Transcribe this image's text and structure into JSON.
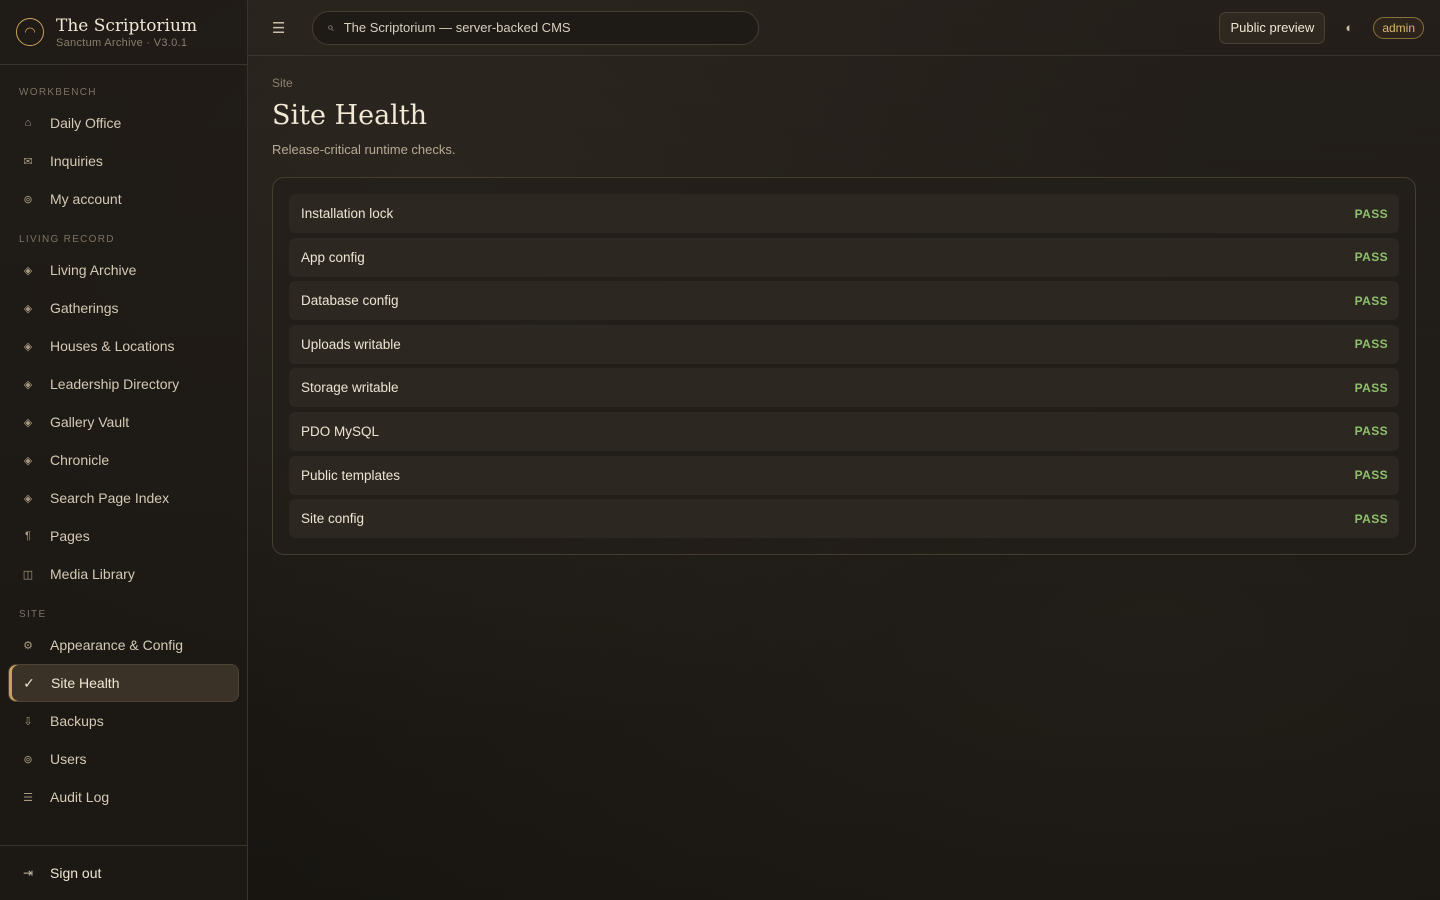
{
  "brand": {
    "title": "The Scriptorium",
    "subtitle": "Sanctum Archive · V3.0.1",
    "logo_icon": "circle-logo-icon"
  },
  "sidebar": {
    "sections": [
      {
        "label": "WORKBENCH",
        "items": [
          {
            "label": "Daily Office",
            "icon": "home-icon",
            "glyph": "⌂"
          },
          {
            "label": "Inquiries",
            "icon": "mail-icon",
            "glyph": "✉"
          },
          {
            "label": "My account",
            "icon": "account-icon",
            "glyph": "⊚"
          }
        ]
      },
      {
        "label": "LIVING RECORD",
        "items": [
          {
            "label": "Living Archive",
            "icon": "diamond-icon",
            "glyph": "◈"
          },
          {
            "label": "Gatherings",
            "icon": "diamond-icon",
            "glyph": "◈"
          },
          {
            "label": "Houses & Locations",
            "icon": "diamond-icon",
            "glyph": "◈"
          },
          {
            "label": "Leadership Directory",
            "icon": "diamond-icon",
            "glyph": "◈"
          },
          {
            "label": "Gallery Vault",
            "icon": "diamond-icon",
            "glyph": "◈"
          },
          {
            "label": "Chronicle",
            "icon": "diamond-icon",
            "glyph": "◈"
          },
          {
            "label": "Search Page Index",
            "icon": "diamond-icon",
            "glyph": "◈"
          },
          {
            "label": "Pages",
            "icon": "pilcrow-icon",
            "glyph": "¶"
          },
          {
            "label": "Media Library",
            "icon": "book-icon",
            "glyph": "◫"
          }
        ]
      },
      {
        "label": "SITE",
        "items": [
          {
            "label": "Appearance & Config",
            "icon": "gear-icon",
            "glyph": "⚙"
          },
          {
            "label": "Site Health",
            "icon": "check-icon",
            "glyph": "✓",
            "active": true
          },
          {
            "label": "Backups",
            "icon": "download-icon",
            "glyph": "⇩"
          },
          {
            "label": "Users",
            "icon": "users-icon",
            "glyph": "⊚"
          },
          {
            "label": "Audit Log",
            "icon": "list-icon",
            "glyph": "☰"
          }
        ]
      }
    ],
    "signout": {
      "label": "Sign out",
      "icon": "sign-out-icon",
      "glyph": "⇥"
    }
  },
  "topbar": {
    "menu_icon": "hamburger-icon",
    "search_icon": "search-icon",
    "search_placeholder": "The Scriptorium — server-backed CMS",
    "preview_label": "Public preview",
    "theme_icon": "theme-toggle-icon",
    "user_badge": "admin"
  },
  "page": {
    "breadcrumb": "Site",
    "title": "Site Health",
    "subtitle": "Release-critical runtime checks."
  },
  "checks": [
    {
      "name": "Installation lock",
      "status": "PASS"
    },
    {
      "name": "App config",
      "status": "PASS"
    },
    {
      "name": "Database config",
      "status": "PASS"
    },
    {
      "name": "Uploads writable",
      "status": "PASS"
    },
    {
      "name": "Storage writable",
      "status": "PASS"
    },
    {
      "name": "PDO MySQL",
      "status": "PASS"
    },
    {
      "name": "Public templates",
      "status": "PASS"
    },
    {
      "name": "Site config",
      "status": "PASS"
    }
  ],
  "colors": {
    "accent": "#c9a05c",
    "pass": "#8fbf6f",
    "background": "#1c1915"
  }
}
